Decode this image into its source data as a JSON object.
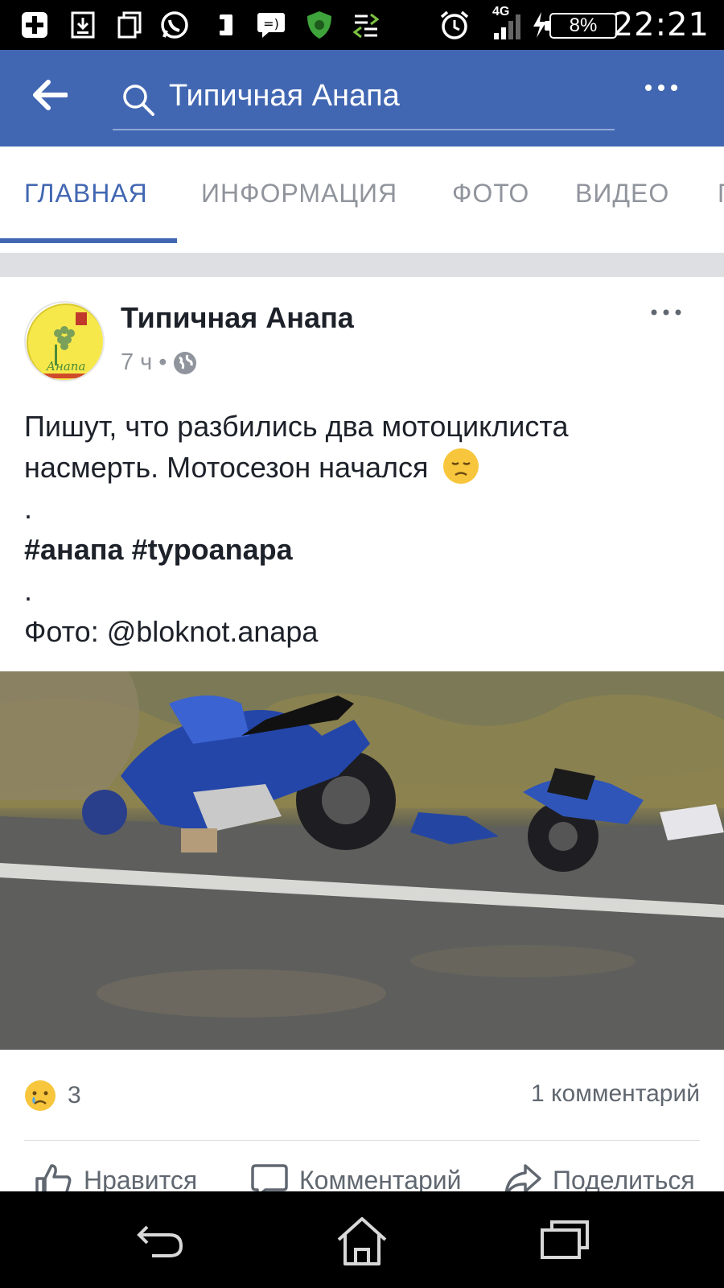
{
  "status_bar": {
    "network": "4G",
    "battery": "8%",
    "time": "22:21"
  },
  "app_bar": {
    "search_text": "Типичная Анапа"
  },
  "tabs": [
    {
      "label": "ГЛАВНАЯ",
      "active": true
    },
    {
      "label": "ИНФОРМАЦИЯ",
      "active": false
    },
    {
      "label": "ФОТО",
      "active": false
    },
    {
      "label": "ВИДЕО",
      "active": false
    },
    {
      "label": "Г",
      "active": false
    }
  ],
  "post": {
    "author": "Типичная Анапа",
    "time": "7 ч",
    "meta_separator": "•",
    "avatar_text": "Анапа",
    "text_lines": [
      "Пишут, что разбились два мотоциклиста",
      "насмерть. Мотосезон начался",
      ".",
      "#анапа #typoanapa",
      ".",
      "Фото: @bloknot.anapa"
    ],
    "reaction_count": "3",
    "comments_label": "1 комментарий",
    "actions": {
      "like": "Нравится",
      "comment": "Комментарий",
      "share": "Поделиться"
    }
  },
  "colors": {
    "brand": "#4267b2",
    "tab_inactive": "#90949c",
    "text": "#1d2129"
  }
}
